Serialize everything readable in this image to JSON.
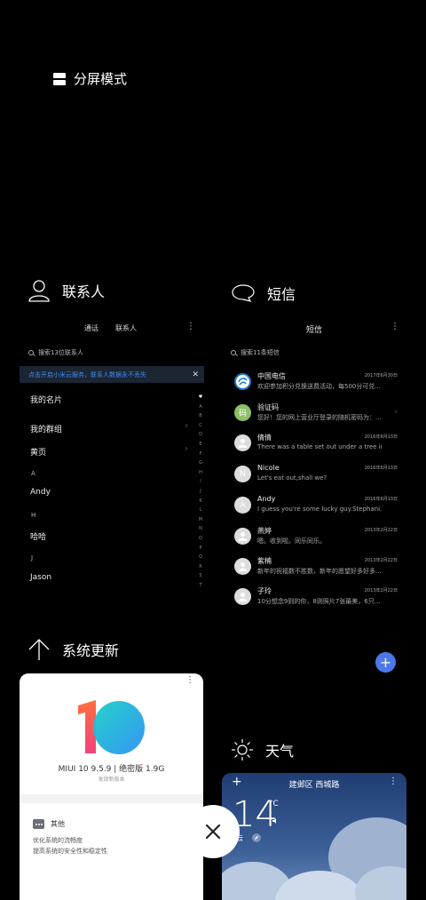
{
  "split_screen": {
    "label": "分屏模式"
  },
  "contacts": {
    "app_title": "联系人",
    "tabs": [
      "通话",
      "联系人"
    ],
    "menu": "⋮",
    "search_placeholder": "搜索13位联系人",
    "banner": "点击开启小米云服务，联系人数据永不丢失",
    "banner_close": "✕",
    "items": {
      "my_card": "我的名片",
      "my_groups": "我的群组",
      "yellow_pages": "黄页",
      "letter_a": "A",
      "andy": "Andy",
      "letter_h": "H",
      "haha": "哈哈",
      "letter_j": "J",
      "jason": "Jason"
    },
    "index": [
      "♥",
      "A",
      "B",
      "C",
      "D",
      "E",
      "F",
      "G",
      "H",
      "I",
      "J",
      "K",
      "L",
      "M",
      "N",
      "O",
      "P",
      "Q",
      "R",
      "S",
      "T"
    ]
  },
  "messages": {
    "app_title": "短信",
    "title": "短信",
    "menu": "⋮",
    "search_placeholder": "搜索11条短信",
    "threads": [
      {
        "avatar": "",
        "name": "中国电信",
        "text": "欢迎参加积分兑换送费活动，每500分可兑...",
        "date": "2017年6月30日"
      },
      {
        "avatar": "码",
        "name": "验证码",
        "text": "您好！您的网上营业厅登录的随机密码为：...",
        "date": ""
      },
      {
        "avatar": "",
        "name": "倩倩",
        "text": "There was a table set out under a tree in...",
        "date": "2016年6月13日"
      },
      {
        "avatar": "N",
        "name": "Nicole",
        "text": "Let's eat out,shall we?",
        "date": "2016年6月13日"
      },
      {
        "avatar": "A",
        "name": "Andy",
        "text": "I guess you're some lucky guy.Stephani...",
        "date": "2016年6月13日"
      },
      {
        "avatar": "",
        "name": "燕婷",
        "text": "嗯。收到啦。同乐同乐。",
        "date": "2013年2月22日"
      },
      {
        "avatar": "",
        "name": "紫楠",
        "text": "新年的祝福数不胜数，新年的愿望好多好多...",
        "date": "2013年2月22日"
      },
      {
        "avatar": "",
        "name": "子玲",
        "text": "10分想念9则的你，8则照片7张最美，6只...",
        "date": "2013年2月22日"
      }
    ],
    "fab": "+"
  },
  "update": {
    "app_title": "系统更新",
    "more": "⋮",
    "version": "MIUI 10 9.5.9 | 绝密版 1.9G",
    "new_version": "发现新版本",
    "other": "其他",
    "lines": [
      "优化系统的流畅度",
      "提高系统的安全性和稳定性"
    ]
  },
  "weather": {
    "app_title": "天气",
    "plus": "+",
    "location": "建邺区 西城路",
    "more": "⋮",
    "temperature": "14",
    "unit": "°C",
    "condition": "云"
  },
  "close": {
    "icon": "close-icon"
  }
}
